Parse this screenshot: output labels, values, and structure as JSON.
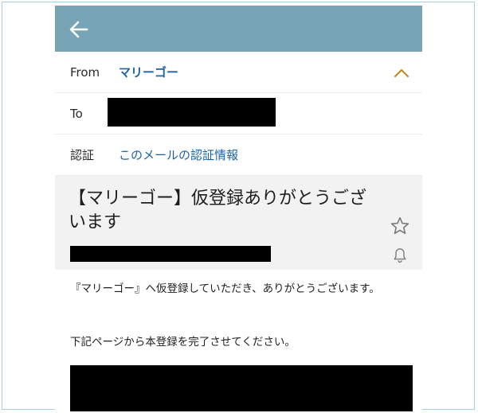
{
  "header": {
    "back_icon": "arrow-left-icon",
    "bar_color": "#77a5b6"
  },
  "from": {
    "label": "From",
    "sender": "マリーゴー",
    "collapse_icon": "chevron-up-icon"
  },
  "to": {
    "label": "To"
  },
  "auth": {
    "label": "認証",
    "link": "このメールの認証情報"
  },
  "subject": {
    "text": "【マリーゴー】仮登録ありがとうございます",
    "star_icon": "star-outline-icon",
    "bell_icon": "bell-icon"
  },
  "body": {
    "line1": "『マリーゴー』へ仮登録していただき、ありがとうございます。",
    "line2": "下記ページから本登録を完了させてください。"
  },
  "colors": {
    "link": "#1b63a8",
    "accent_chevron": "#b98a1c"
  }
}
